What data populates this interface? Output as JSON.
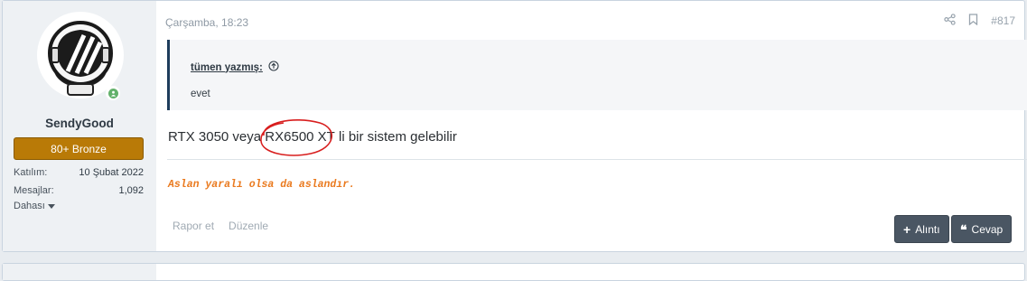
{
  "user": {
    "username": "SendyGood",
    "rank": "80+ Bronze",
    "stats": [
      {
        "label": "Katılım:",
        "value": "10 Şubat 2022"
      },
      {
        "label": "Mesajlar:",
        "value": "1,092"
      }
    ],
    "more": "Dahası",
    "online": true
  },
  "post": {
    "date": "Çarşamba, 18:23",
    "number": "#817",
    "quote": {
      "author": "tümen yazmış:",
      "text": "evet"
    },
    "message": {
      "before": "RTX 3050 veya ",
      "highlight": "RX6500 XT",
      "after": " li bir sistem gelebilir"
    },
    "signature": "Aslan yaralı olsa da aslandır.",
    "footer_links": [
      "Rapor et",
      "Düzenle"
    ],
    "buttons": {
      "quote": "Alıntı",
      "reply": "Cevap"
    }
  },
  "colors": {
    "rank_badge": "#b97a07",
    "signature": "#ea7a1f",
    "quote_border": "#1e3d5c",
    "button_bg": "#4a5663",
    "online": "#63b16b",
    "annotation_circle": "#d81e1e"
  }
}
